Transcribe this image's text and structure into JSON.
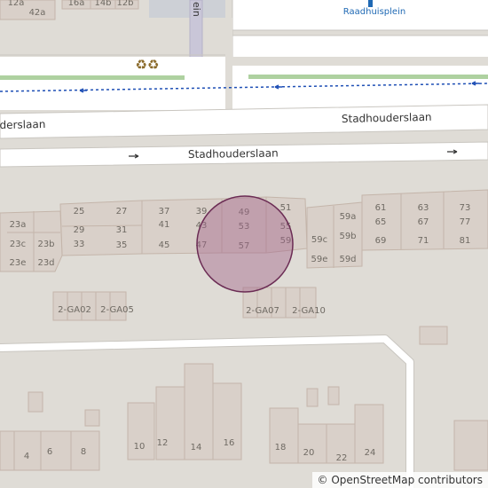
{
  "map": {
    "streets": {
      "upper": "Stadhouderslaan",
      "lower": "Stadhouderslaan",
      "side_fragment": "ein"
    },
    "poi": {
      "label": "Raadhuisplein"
    },
    "house_numbers": {
      "top_row": [
        "12a",
        "16a",
        "14b",
        "12b",
        "42a"
      ],
      "main_block": [
        "25",
        "27",
        "37",
        "39",
        "49",
        "51",
        "29",
        "31",
        "41",
        "43",
        "53",
        "55",
        "33",
        "35",
        "45",
        "47",
        "57",
        "59"
      ],
      "west_block": [
        "23a",
        "23c",
        "23b",
        "23e",
        "23d"
      ],
      "east_block": [
        "59a",
        "61",
        "63",
        "73",
        "65",
        "67",
        "77",
        "59b",
        "59c",
        "69",
        "71",
        "81",
        "59e",
        "59d"
      ],
      "garages": [
        "2-GA02",
        "2-GA05",
        "2-GA07",
        "2-GA10"
      ],
      "bottom_row": [
        "4",
        "6",
        "8",
        "10",
        "12",
        "14",
        "16",
        "18",
        "20",
        "22",
        "24"
      ]
    },
    "colors": {
      "background": "#dfdcd6",
      "building": "#d9d0c9",
      "building_stroke": "#c4b5aa",
      "road": "#ffffff",
      "road_casing": "#c9c6c0",
      "green_strip": "#aed1a0",
      "path_blue": "#1e4fb5",
      "marker_fill": "#a5678b",
      "marker_stroke": "#6b2c54",
      "poi_blue": "#1f69b4",
      "recycling": "#8a6a2a"
    },
    "icons": {
      "recycling": "recycling-icon",
      "poi": "poi-marker-icon",
      "arrow": "one-way-arrow-icon"
    }
  },
  "attribution": {
    "copyright": "©",
    "link": "OpenStreetMap",
    "suffix": "contributors"
  }
}
